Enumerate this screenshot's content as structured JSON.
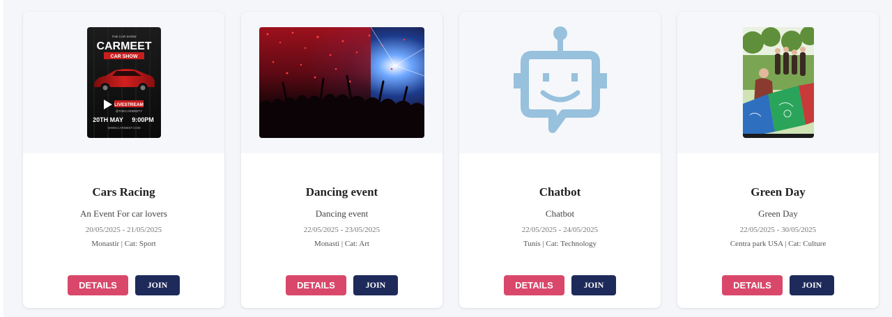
{
  "events": [
    {
      "title": "Cars Racing",
      "description": "An Event For car lovers",
      "dates": "20/05/2025 - 21/05/2025",
      "meta": "Monastir | Cat: Sport",
      "poster": {
        "small": "THE CAR SHOW",
        "brand": "CARMEET",
        "sub": "CAR SHOW",
        "live": "LIVESTREAM",
        "handle": "@THECARMEETY",
        "date": "20TH MAY",
        "time": "9:00PM",
        "url": "WWW.CARMEET.COM"
      }
    },
    {
      "title": "Dancing event",
      "description": "Dancing event",
      "dates": "22/05/2025 - 23/05/2025",
      "meta": "Monasti | Cat: Art"
    },
    {
      "title": "Chatbot",
      "description": "Chatbot",
      "dates": "22/05/2025 - 24/05/2025",
      "meta": "Tunis | Cat: Technology"
    },
    {
      "title": "Green Day",
      "description": "Green Day",
      "dates": "22/05/2025 - 30/05/2025",
      "meta": "Centra park USA | Cat: Culture"
    }
  ],
  "buttons": {
    "details_label": "DETAILS",
    "join_label": "JOIN"
  },
  "colors": {
    "details": "#d9486a",
    "join": "#1e2a5a",
    "robot_icon": "#97c1dd"
  },
  "icons": [
    "chatbot-robot-icon",
    "play-icon"
  ]
}
